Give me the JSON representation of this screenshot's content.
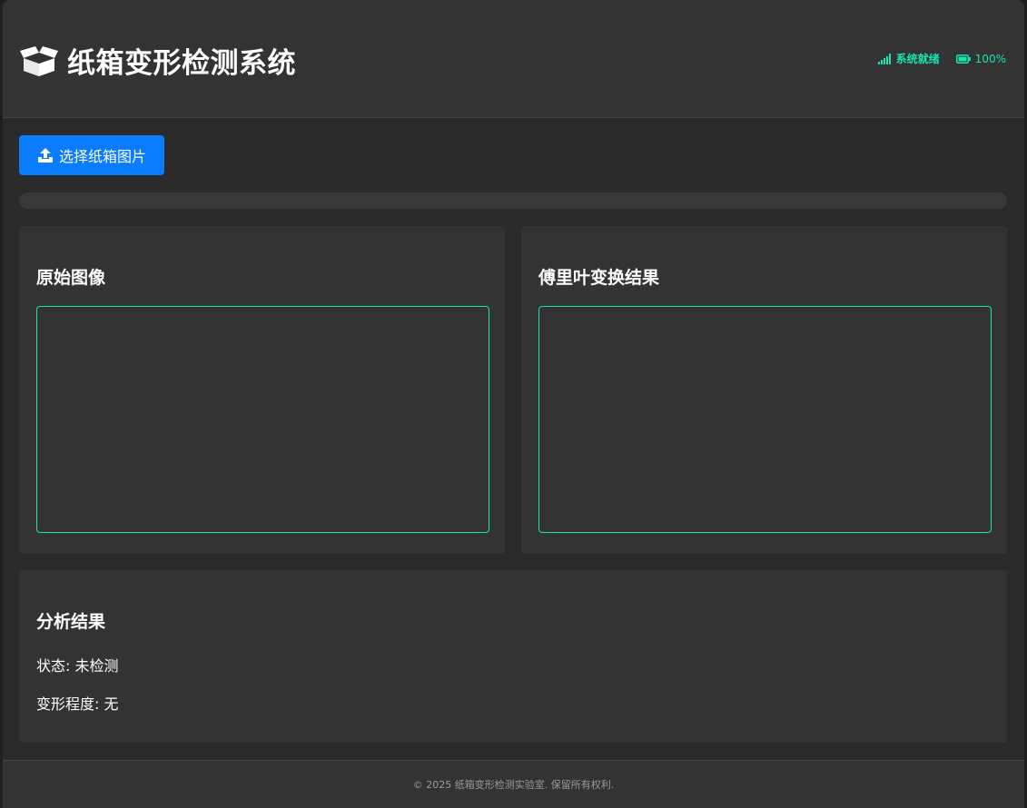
{
  "app": {
    "title": "纸箱变形检测系统",
    "icon": "box-open-icon"
  },
  "status": {
    "signal_icon": "signal-icon",
    "signal_label": "系统就绪",
    "battery_icon": "battery-icon",
    "battery_label": "100%"
  },
  "toolbar": {
    "upload_icon": "upload-icon",
    "upload_label": "选择纸箱图片"
  },
  "progress": {
    "value": 0
  },
  "panels": {
    "original_title": "原始图像",
    "fourier_title": "傅里叶变换结果"
  },
  "analysis": {
    "title": "分析结果",
    "status_line": "状态: 未检测",
    "degree_line": "变形程度: 无"
  },
  "footer": {
    "text": "© 2025 纸箱变形检测实验室. 保留所有权利."
  },
  "colors": {
    "accent": "#17e3b3",
    "primary": "#0a7cff",
    "panel": "#333333",
    "background": "#2a2a2a"
  }
}
